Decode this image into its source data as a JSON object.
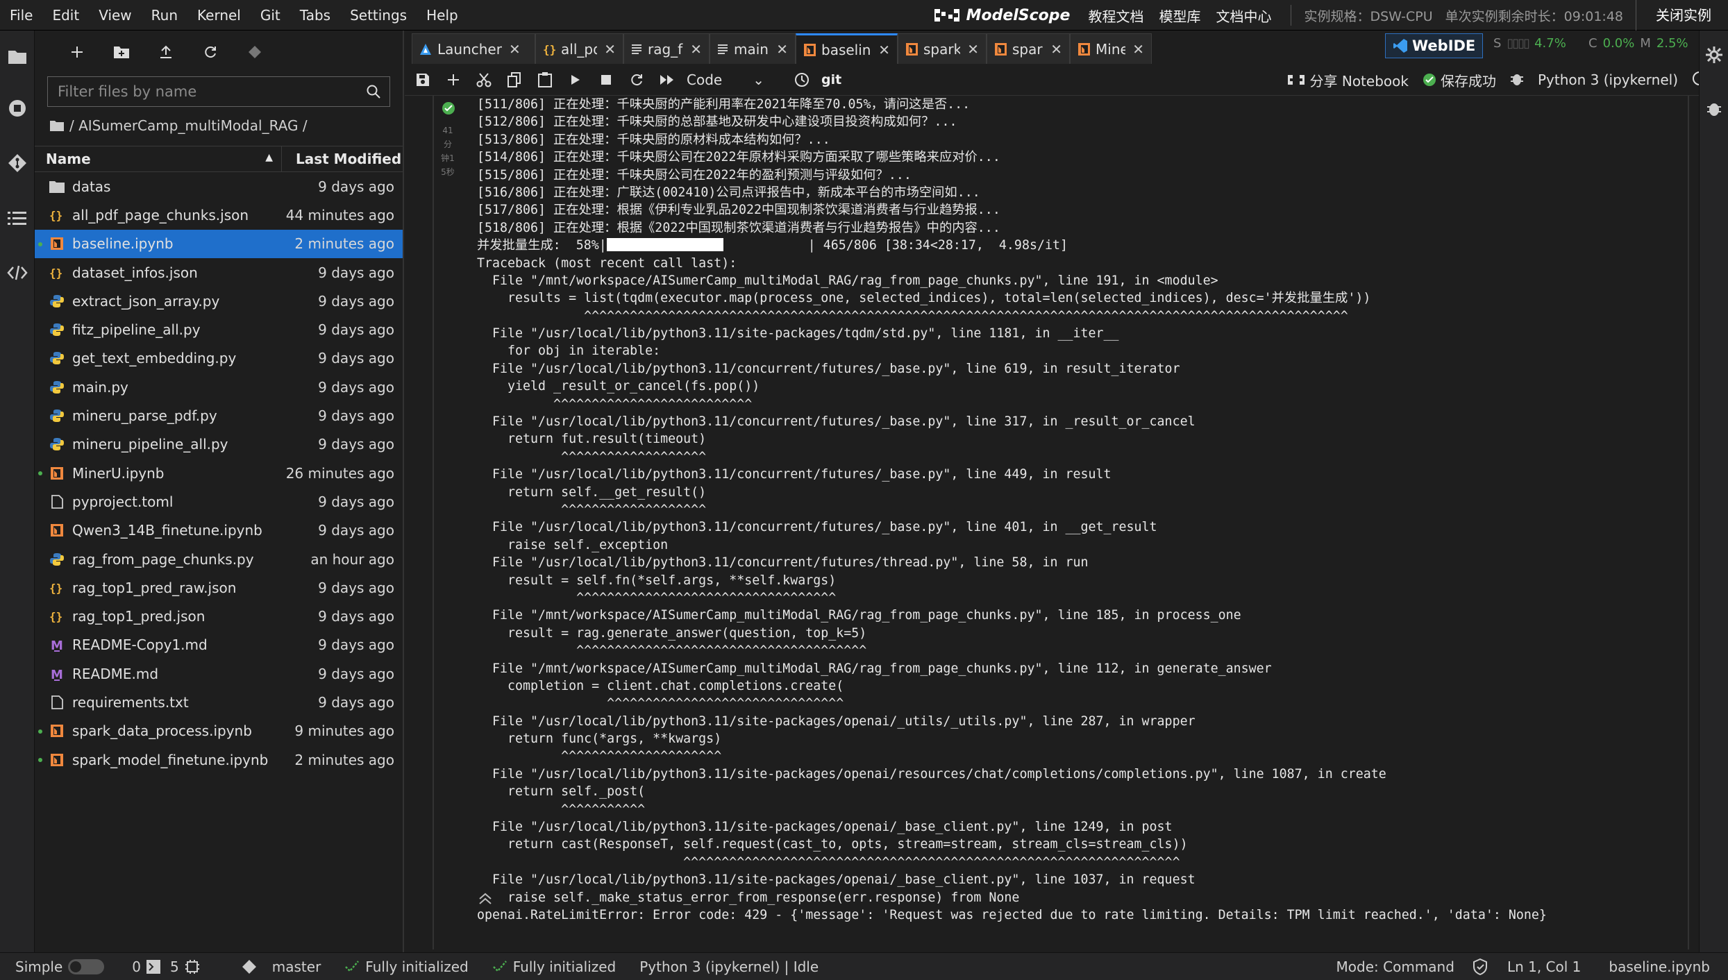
{
  "menubar": {
    "items": [
      "File",
      "Edit",
      "View",
      "Run",
      "Kernel",
      "Git",
      "Tabs",
      "Settings",
      "Help"
    ],
    "brand": "ModelScope",
    "links": [
      "教程文档",
      "模型库",
      "文档中心"
    ],
    "spec": "实例规格：DSW-CPU",
    "remaining": "单次实例剩余时长：09:01:48",
    "close_button": "关闭实例"
  },
  "filebrowser": {
    "filter_placeholder": "Filter files by name",
    "breadcrumb": "/ AISumerCamp_multiModal_RAG /",
    "col_name": "Name",
    "col_modified": "Last Modified",
    "files": [
      {
        "name": "datas",
        "modified": "9 days ago",
        "icon": "folder-icon",
        "dot": false
      },
      {
        "name": "all_pdf_page_chunks.json",
        "modified": "44 minutes ago",
        "icon": "json-icon",
        "dot": false
      },
      {
        "name": "baseline.ipynb",
        "modified": "2 minutes ago",
        "icon": "notebook-icon",
        "dot": true
      },
      {
        "name": "dataset_infos.json",
        "modified": "9 days ago",
        "icon": "json-icon",
        "dot": false
      },
      {
        "name": "extract_json_array.py",
        "modified": "9 days ago",
        "icon": "python-icon",
        "dot": false
      },
      {
        "name": "fitz_pipeline_all.py",
        "modified": "9 days ago",
        "icon": "python-icon",
        "dot": false
      },
      {
        "name": "get_text_embedding.py",
        "modified": "9 days ago",
        "icon": "python-icon",
        "dot": false
      },
      {
        "name": "main.py",
        "modified": "9 days ago",
        "icon": "python-icon",
        "dot": false
      },
      {
        "name": "mineru_parse_pdf.py",
        "modified": "9 days ago",
        "icon": "python-icon",
        "dot": false
      },
      {
        "name": "mineru_pipeline_all.py",
        "modified": "9 days ago",
        "icon": "python-icon",
        "dot": false
      },
      {
        "name": "MinerU.ipynb",
        "modified": "26 minutes ago",
        "icon": "notebook-icon",
        "dot": true
      },
      {
        "name": "pyproject.toml",
        "modified": "9 days ago",
        "icon": "file-icon",
        "dot": false
      },
      {
        "name": "Qwen3_14B_finetune.ipynb",
        "modified": "9 days ago",
        "icon": "notebook-icon",
        "dot": false
      },
      {
        "name": "rag_from_page_chunks.py",
        "modified": "an hour ago",
        "icon": "python-icon",
        "dot": false
      },
      {
        "name": "rag_top1_pred_raw.json",
        "modified": "9 days ago",
        "icon": "json-icon",
        "dot": false
      },
      {
        "name": "rag_top1_pred.json",
        "modified": "9 days ago",
        "icon": "json-icon",
        "dot": false
      },
      {
        "name": "README-Copy1.md",
        "modified": "9 days ago",
        "icon": "markdown-icon",
        "dot": false
      },
      {
        "name": "README.md",
        "modified": "9 days ago",
        "icon": "markdown-icon",
        "dot": false
      },
      {
        "name": "requirements.txt",
        "modified": "9 days ago",
        "icon": "file-icon",
        "dot": false
      },
      {
        "name": "spark_data_process.ipynb",
        "modified": "9 minutes ago",
        "icon": "notebook-icon",
        "dot": true
      },
      {
        "name": "spark_model_finetune.ipynb",
        "modified": "2 minutes ago",
        "icon": "notebook-icon",
        "dot": true
      }
    ]
  },
  "tabs": [
    {
      "label": "Launcher",
      "icon": "launcher-icon"
    },
    {
      "label": "all_pdf_page",
      "icon": "json-icon"
    },
    {
      "label": "rag_from_pa",
      "icon": "text-icon"
    },
    {
      "label": "main.py",
      "icon": "text-icon"
    },
    {
      "label": "baseline.ipyı",
      "icon": "notebook-icon",
      "active": true
    },
    {
      "label": "spark_mode",
      "icon": "notebook-icon"
    },
    {
      "label": "spark_data_p",
      "icon": "notebook-icon"
    },
    {
      "label": "MinerU.ipy",
      "icon": "notebook-icon"
    }
  ],
  "webide": "WebIDE",
  "resources": {
    "s_label": "S",
    "s_value": "4.7%",
    "c_label": "C",
    "c_value": "0.0%",
    "m_label": "M",
    "m_value": "2.5%"
  },
  "nbtoolbar": {
    "cell_type": "Code",
    "git": "git",
    "share": "分享 Notebook",
    "saved": "保存成功",
    "kernel": "Python 3 (ipykernel)"
  },
  "gutter": {
    "exec": "41",
    "lines": [
      "分",
      "钟1",
      "5秒"
    ]
  },
  "output_lines": [
    "[511/806] 正在处理：千味央厨的产能利用率在2021年降至70.05%，请问这是否...",
    "[512/806] 正在处理：千味央厨的总部基地及研发中心建设项目投资构成如何？...",
    "[513/806] 正在处理：千味央厨的原材料成本结构如何？...",
    "[514/806] 正在处理：千味央厨公司在2022年原材料采购方面采取了哪些策略来应对价...",
    "[515/806] 正在处理：千味央厨公司在2022年的盈利预测与评级如何？...",
    "[516/806] 正在处理：广联达(002410)公司点评报告中，新成本平台的市场空间如...",
    "[517/806] 正在处理：根据《伊利专业乳品2022中国现制茶饮渠道消费者与行业趋势报...",
    "[518/806] 正在处理：根据《2022中国现制茶饮渠道消费者与行业趋势报告》中的内容...",
    "__PROGRESS__",
    "Traceback (most recent call last):",
    "  File \"/mnt/workspace/AISumerCamp_multiModal_RAG/rag_from_page_chunks.py\", line 191, in <module>",
    "    results = list(tqdm(executor.map(process_one, selected_indices), total=len(selected_indices), desc='并发批量生成'))",
    "              ^^^^^^^^^^^^^^^^^^^^^^^^^^^^^^^^^^^^^^^^^^^^^^^^^^^^^^^^^^^^^^^^^^^^^^^^^^^^^^^^^^^^^^^^^^^^^^^^^^^^",
    "  File \"/usr/local/lib/python3.11/site-packages/tqdm/std.py\", line 1181, in __iter__",
    "    for obj in iterable:",
    "  File \"/usr/local/lib/python3.11/concurrent/futures/_base.py\", line 619, in result_iterator",
    "    yield _result_or_cancel(fs.pop())",
    "          ^^^^^^^^^^^^^^^^^^^^^^^^^^",
    "  File \"/usr/local/lib/python3.11/concurrent/futures/_base.py\", line 317, in _result_or_cancel",
    "    return fut.result(timeout)",
    "           ^^^^^^^^^^^^^^^^^^^",
    "  File \"/usr/local/lib/python3.11/concurrent/futures/_base.py\", line 449, in result",
    "    return self.__get_result()",
    "           ^^^^^^^^^^^^^^^^^^^",
    "  File \"/usr/local/lib/python3.11/concurrent/futures/_base.py\", line 401, in __get_result",
    "    raise self._exception",
    "  File \"/usr/local/lib/python3.11/concurrent/futures/thread.py\", line 58, in run",
    "    result = self.fn(*self.args, **self.kwargs)",
    "             ^^^^^^^^^^^^^^^^^^^^^^^^^^^^^^^^^^",
    "  File \"/mnt/workspace/AISumerCamp_multiModal_RAG/rag_from_page_chunks.py\", line 185, in process_one",
    "    result = rag.generate_answer(question, top_k=5)",
    "             ^^^^^^^^^^^^^^^^^^^^^^^^^^^^^^^^^^^^^^",
    "  File \"/mnt/workspace/AISumerCamp_multiModal_RAG/rag_from_page_chunks.py\", line 112, in generate_answer",
    "    completion = client.chat.completions.create(",
    "                 ^^^^^^^^^^^^^^^^^^^^^^^^^^^^^^^",
    "  File \"/usr/local/lib/python3.11/site-packages/openai/_utils/_utils.py\", line 287, in wrapper",
    "    return func(*args, **kwargs)",
    "           ^^^^^^^^^^^^^^^^^^^^^",
    "  File \"/usr/local/lib/python3.11/site-packages/openai/resources/chat/completions/completions.py\", line 1087, in create",
    "    return self._post(",
    "           ^^^^^^^^^^^",
    "  File \"/usr/local/lib/python3.11/site-packages/openai/_base_client.py\", line 1249, in post",
    "    return cast(ResponseT, self.request(cast_to, opts, stream=stream, stream_cls=stream_cls))",
    "                           ^^^^^^^^^^^^^^^^^^^^^^^^^^^^^^^^^^^^^^^^^^^^^^^^^^^^^^^^^^^^^^^^^",
    "  File \"/usr/local/lib/python3.11/site-packages/openai/_base_client.py\", line 1037, in request",
    "    raise self._make_status_error_from_response(err.response) from None",
    "openai.RateLimitError: Error code: 429 - {'message': 'Request was rejected due to rate limiting. Details: TPM limit reached.', 'data': None}"
  ],
  "progress": {
    "label": "并发批量生成:",
    "percent": "58%",
    "fraction": 0.58,
    "stats": "| 465/806 [38:34<28:17,  4.98s/it]"
  },
  "status": {
    "mode_label": "Simple",
    "count1": "0",
    "count2": "5",
    "branch": "master",
    "lsp1": "Fully initialized",
    "lsp2": "Fully initialized",
    "kernel_status": "Python 3 (ipykernel) | Idle",
    "mode": "Mode: Command",
    "cursor": "Ln 1, Col 1",
    "file": "baseline.ipynb"
  },
  "colors": {
    "accent": "#1f6fcb",
    "green": "#4caf50",
    "orange": "#f0883e"
  }
}
